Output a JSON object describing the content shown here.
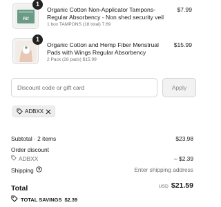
{
  "items": [
    {
      "quantity": "1",
      "name": "Organic Cotton Non-Applicator Tampons- Regular Absorbency - Non shed security veil",
      "meta": "1 box TAMPONS (18 total) 7.69",
      "price": "$7.99",
      "image_icon": "tampon-box-image"
    },
    {
      "quantity": "1",
      "name": "Organic Cotton and Hemp Fiber Menstrual Pads with Wings Regular Absorbency",
      "meta": "2 Pack (28 pads) $15.99",
      "price": "$15.99",
      "image_icon": "pad-hand-image"
    }
  ],
  "discount": {
    "placeholder": "Discount code or gift card",
    "value": "",
    "apply_label": "Apply"
  },
  "applied_code": {
    "code": "ADBXX",
    "remove_icon": "close-icon",
    "tag_icon": "tag-icon"
  },
  "summary": {
    "subtotal_label": "Subtotal · 2 items",
    "subtotal_value": "$23.98",
    "order_discount_label": "Order discount",
    "order_discount_code": "ADBXX",
    "order_discount_value": "– $2.39",
    "shipping_label": "Shipping",
    "shipping_value": "Enter shipping address",
    "total_label": "Total",
    "currency": "USD",
    "total_value": "$21.59",
    "savings_label": "TOTAL SAVINGS",
    "savings_value": "$2.39"
  },
  "colors": {
    "accent": "#1a1a1a",
    "muted": "#707070",
    "border": "#d4d4d4",
    "chip_bg": "#eeeeee",
    "product_green": "#6b9a85"
  }
}
